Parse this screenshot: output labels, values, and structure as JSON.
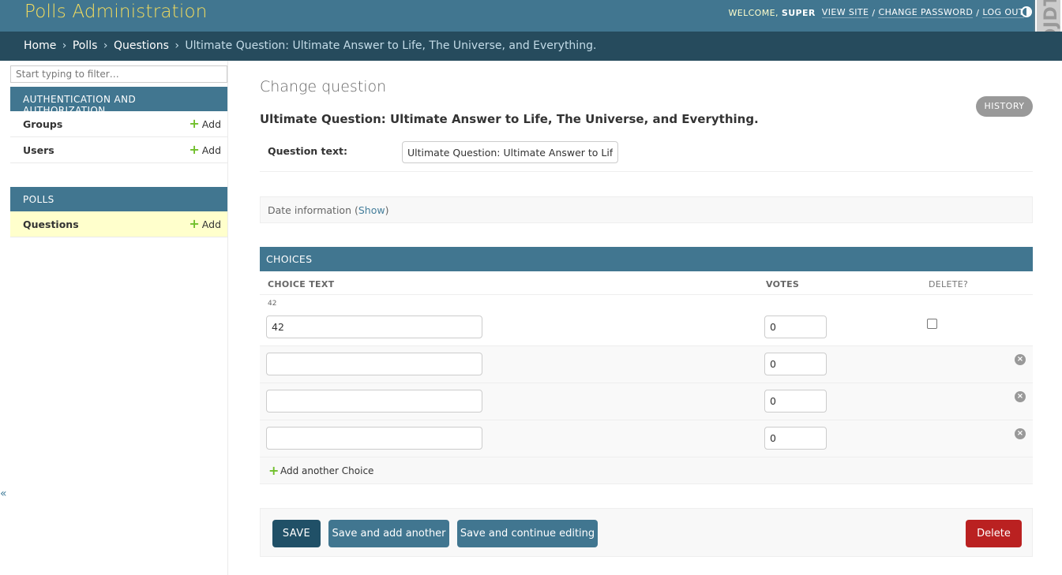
{
  "header": {
    "site_name": "Polls Administration",
    "welcome_label": "WELCOME,",
    "username": "SUPER",
    "view_site": "VIEW SITE",
    "change_password": "CHANGE PASSWORD",
    "log_out": "LOG OUT",
    "separator": "/",
    "debug_toolbar_label": "DJDT"
  },
  "breadcrumbs": {
    "home": "Home",
    "app": "Polls",
    "model": "Questions",
    "current": "Ultimate Question: Ultimate Answer to Life, The Universe, and Everything.",
    "sep": "›"
  },
  "sidebar": {
    "filter_placeholder": "Start typing to filter…",
    "apps": [
      {
        "caption": "AUTHENTICATION AND AUTHORIZATION",
        "models": [
          {
            "name": "Groups",
            "add": "Add"
          },
          {
            "name": "Users",
            "add": "Add"
          }
        ]
      },
      {
        "caption": "POLLS",
        "models": [
          {
            "name": "Questions",
            "add": "Add",
            "current": true
          }
        ]
      }
    ],
    "collapse_icon": "«"
  },
  "main": {
    "heading": "Change question",
    "history": "HISTORY",
    "object_title": "Ultimate Question: Ultimate Answer to Life, The Universe, and Everything.",
    "question_text_label": "Question text:",
    "question_text_value": "Ultimate Question: Ultimate Answer to Life, The Universe, and Everything.",
    "date_info_prefix": "Date information (",
    "date_info_link": "Show",
    "date_info_suffix": ")"
  },
  "choices": {
    "caption": "CHOICES",
    "columns": {
      "choice_text": "CHOICE TEXT",
      "votes": "VOTES",
      "delete": "DELETE?"
    },
    "rows": [
      {
        "original": "42",
        "choice_text": "42",
        "votes": "0",
        "deletable_checkbox": true
      },
      {
        "original": "",
        "choice_text": "",
        "votes": "0",
        "deletable_checkbox": false
      },
      {
        "original": "",
        "choice_text": "",
        "votes": "0",
        "deletable_checkbox": false
      },
      {
        "original": "",
        "choice_text": "",
        "votes": "0",
        "deletable_checkbox": false
      }
    ],
    "add_another": "Add another Choice",
    "remove_icon": "×"
  },
  "submit": {
    "save": "SAVE",
    "save_add_another": "Save and add another",
    "save_continue": "Save and continue editing",
    "delete": "Delete"
  },
  "colors": {
    "header_bg": "#417690",
    "breadcrumb_bg": "#264b5d",
    "brand_text": "#f5dd5d",
    "add_green": "#70bf2b",
    "delete_red": "#ba2121",
    "current_row": "#ffffcc"
  }
}
